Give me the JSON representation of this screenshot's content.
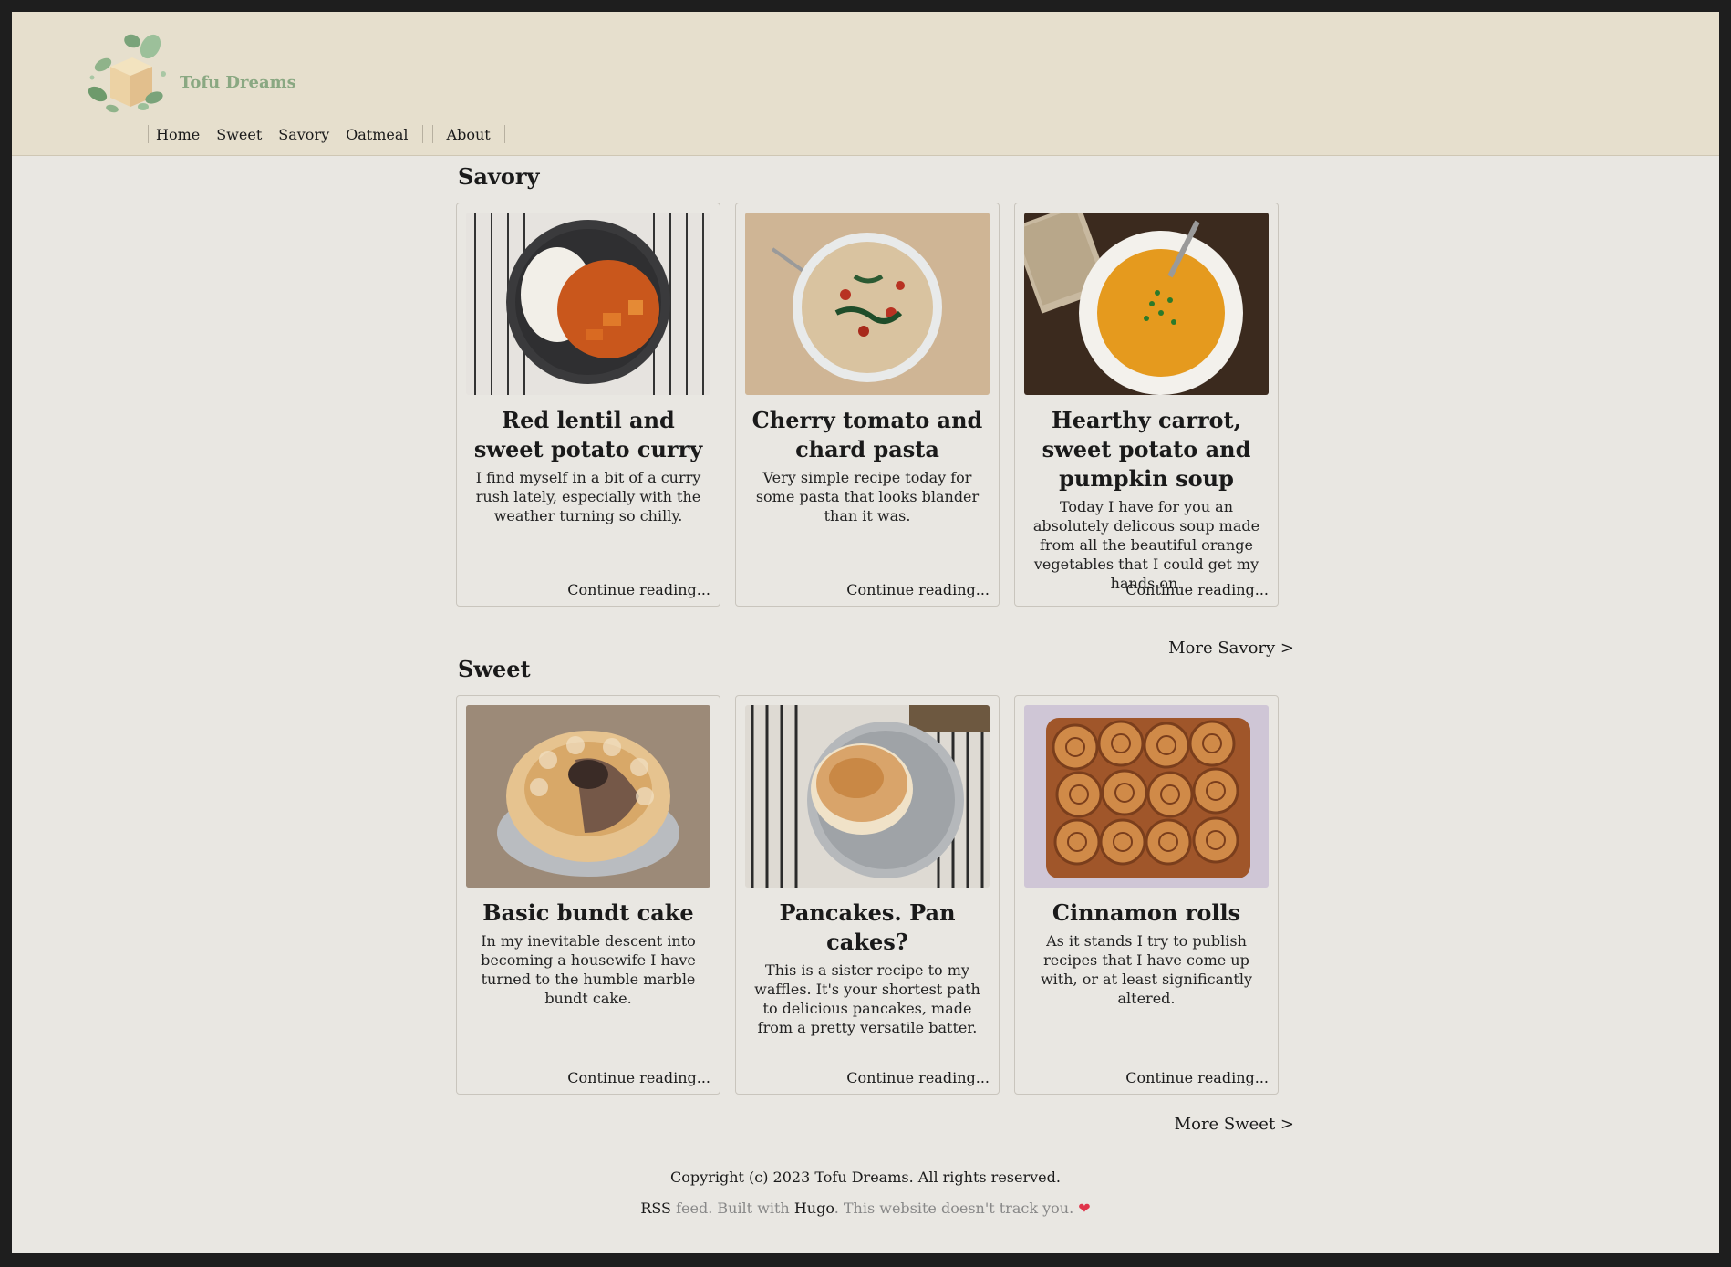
{
  "site": {
    "title": "Tofu Dreams"
  },
  "nav": {
    "items": [
      "Home",
      "Sweet",
      "Savory",
      "Oatmeal",
      "About"
    ]
  },
  "sections": [
    {
      "title": "Savory",
      "more": "More Savory >",
      "cards": [
        {
          "title": "Red lentil and sweet potato curry",
          "excerpt": "I find myself in a bit of a curry rush lately, especially with the weather turning so chilly.",
          "link": "Continue reading..."
        },
        {
          "title": "Cherry tomato and chard pasta",
          "excerpt": "Very simple recipe today for some pasta that looks blander than it was.",
          "link": "Continue reading..."
        },
        {
          "title": "Hearthy carrot, sweet potato and pumpkin soup",
          "excerpt": "Today I have for you an absolutely delicous soup made from all the beautiful orange vegetables that I could get my hands on.",
          "link": "Continue reading..."
        }
      ]
    },
    {
      "title": "Sweet",
      "more": "More Sweet >",
      "cards": [
        {
          "title": "Basic bundt cake",
          "excerpt": "In my inevitable descent into becoming a housewife I have turned to the humble marble bundt cake.",
          "link": "Continue reading..."
        },
        {
          "title": "Pancakes. Pan cakes?",
          "excerpt": "This is a sister recipe to my waffles. It's your shortest path to delicious pancakes, made from a pretty versatile batter.",
          "link": "Continue reading..."
        },
        {
          "title": "Cinnamon rolls",
          "excerpt": "As it stands I try to publish recipes that I have come up with, or at least significantly altered.",
          "link": "Continue reading..."
        }
      ]
    }
  ],
  "footer": {
    "copyright": "Copyright (c) 2023 Tofu Dreams. All rights reserved.",
    "rss": "RSS",
    "feed_text": " feed. Built with ",
    "hugo": "Hugo",
    "tracking": ". This website doesn't track you. ",
    "heart": "❤"
  },
  "colors": {
    "header_bg": "#e6dfcd",
    "page_bg": "#e9e7e2",
    "title_green": "#8aa882",
    "heart": "#e0344a"
  }
}
